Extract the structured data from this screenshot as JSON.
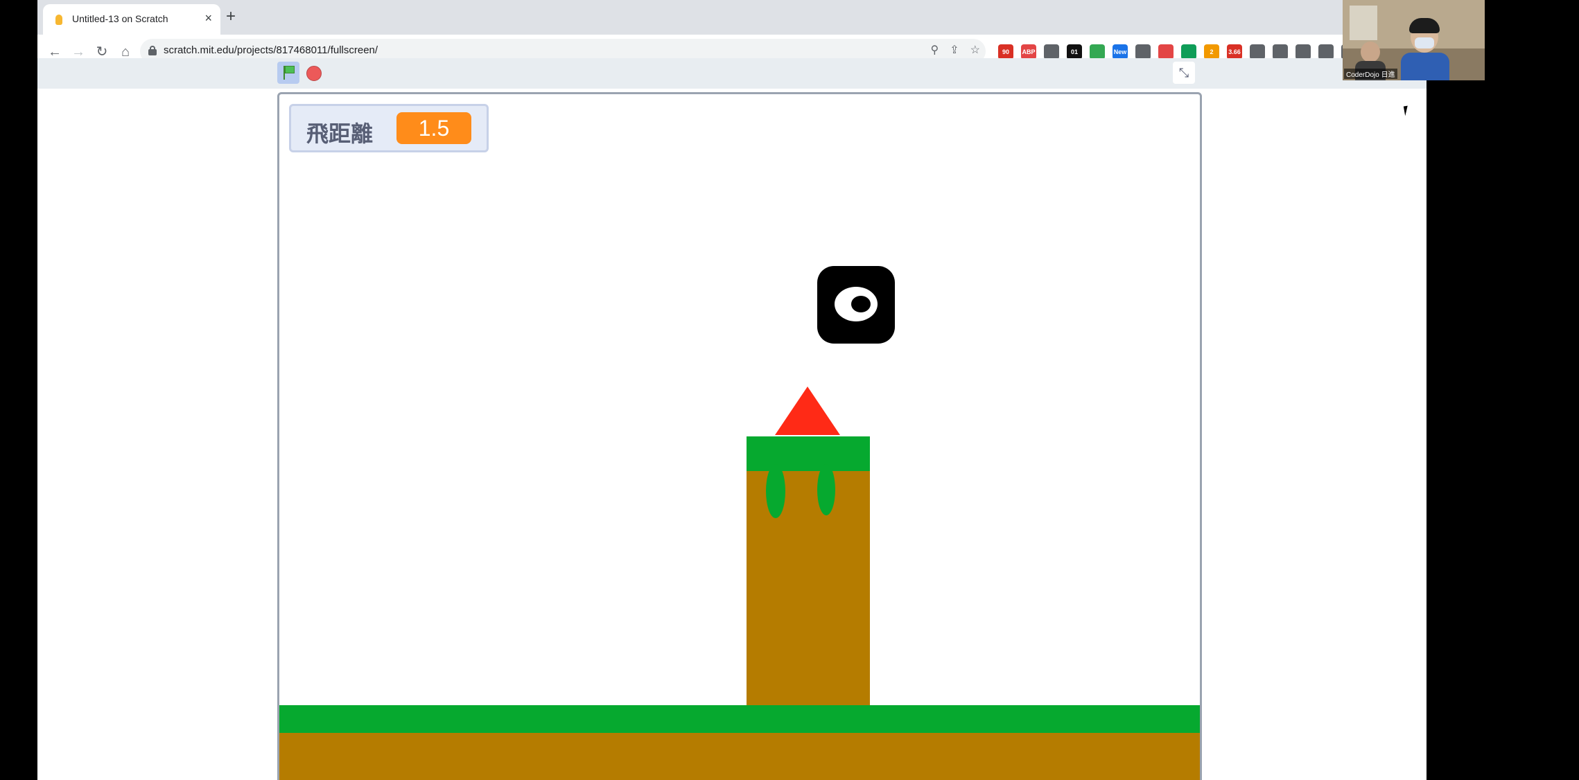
{
  "browser": {
    "tab_title": "Untitled-13 on Scratch",
    "new_tab_icon": "plus-icon",
    "url": "scratch.mit.edu/projects/817468011/fullscreen/",
    "extensions": [
      {
        "label": "90",
        "color": "#d93025"
      },
      {
        "label": "ABP",
        "color": "#e34545"
      },
      {
        "label": "",
        "color": "#5f6368"
      },
      {
        "label": "01",
        "color": "#111111"
      },
      {
        "label": "",
        "color": "#34a853"
      },
      {
        "label": "New",
        "color": "#1a73e8"
      },
      {
        "label": "",
        "color": "#5f6368"
      },
      {
        "label": "",
        "color": "#e34545"
      },
      {
        "label": "",
        "color": "#0f9d58"
      },
      {
        "label": "2",
        "color": "#f29900"
      },
      {
        "label": "3.66",
        "color": "#d93025"
      },
      {
        "label": "",
        "color": "#5f6368"
      },
      {
        "label": "",
        "color": "#5f6368"
      },
      {
        "label": "",
        "color": "#5f6368"
      },
      {
        "label": "",
        "color": "#5f6368"
      },
      {
        "label": "",
        "color": "#5f6368"
      }
    ]
  },
  "scratch": {
    "green_flag_icon": "green-flag-icon",
    "stop_icon": "stop-icon",
    "exit_fullscreen_icon": "exit-fullscreen-icon"
  },
  "stage": {
    "monitor": {
      "label": "飛距離",
      "value": "1.5"
    },
    "colors": {
      "grass": "#06a92f",
      "dirt": "#b57c00",
      "triangle": "#ff2a16",
      "monitor_value_bg": "#ff8c1a"
    }
  },
  "webcam": {
    "label": "CoderDojo 日進"
  }
}
